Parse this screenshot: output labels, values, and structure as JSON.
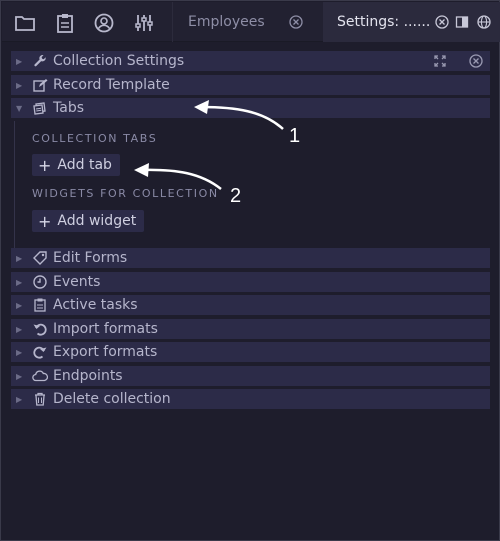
{
  "topbar": {
    "icons": [
      "folder-icon",
      "clipboard-icon",
      "user-circle-icon",
      "sliders-icon"
    ],
    "tabs": [
      {
        "label": "Employees"
      },
      {
        "label": "Settings: ......"
      }
    ]
  },
  "sections": [
    {
      "label": "Collection Settings",
      "icon": "wrench-icon",
      "expanded": false
    },
    {
      "label": "Record Template",
      "icon": "edit-icon",
      "expanded": false
    },
    {
      "label": "Tabs",
      "icon": "tabs-icon",
      "expanded": true
    },
    {
      "label": "Edit Forms",
      "icon": "tag-icon",
      "expanded": false
    },
    {
      "label": "Events",
      "icon": "clock-icon",
      "expanded": false
    },
    {
      "label": "Active tasks",
      "icon": "clipboard-icon",
      "expanded": false
    },
    {
      "label": "Import formats",
      "icon": "undo-icon",
      "expanded": false
    },
    {
      "label": "Export formats",
      "icon": "redo-icon",
      "expanded": false
    },
    {
      "label": "Endpoints",
      "icon": "cloud-icon",
      "expanded": false
    },
    {
      "label": "Delete collection",
      "icon": "trash-icon",
      "expanded": false
    }
  ],
  "tabs_section": {
    "collection_tabs_label": "Collection tabs",
    "add_tab_label": "Add tab",
    "widgets_label": "Widgets for collection",
    "add_widget_label": "Add widget"
  },
  "annotations": {
    "a1": "1",
    "a2": "2"
  },
  "colors": {
    "background": "#1e1d2c",
    "row": "#2c2b48",
    "text": "#b6b6cc"
  }
}
